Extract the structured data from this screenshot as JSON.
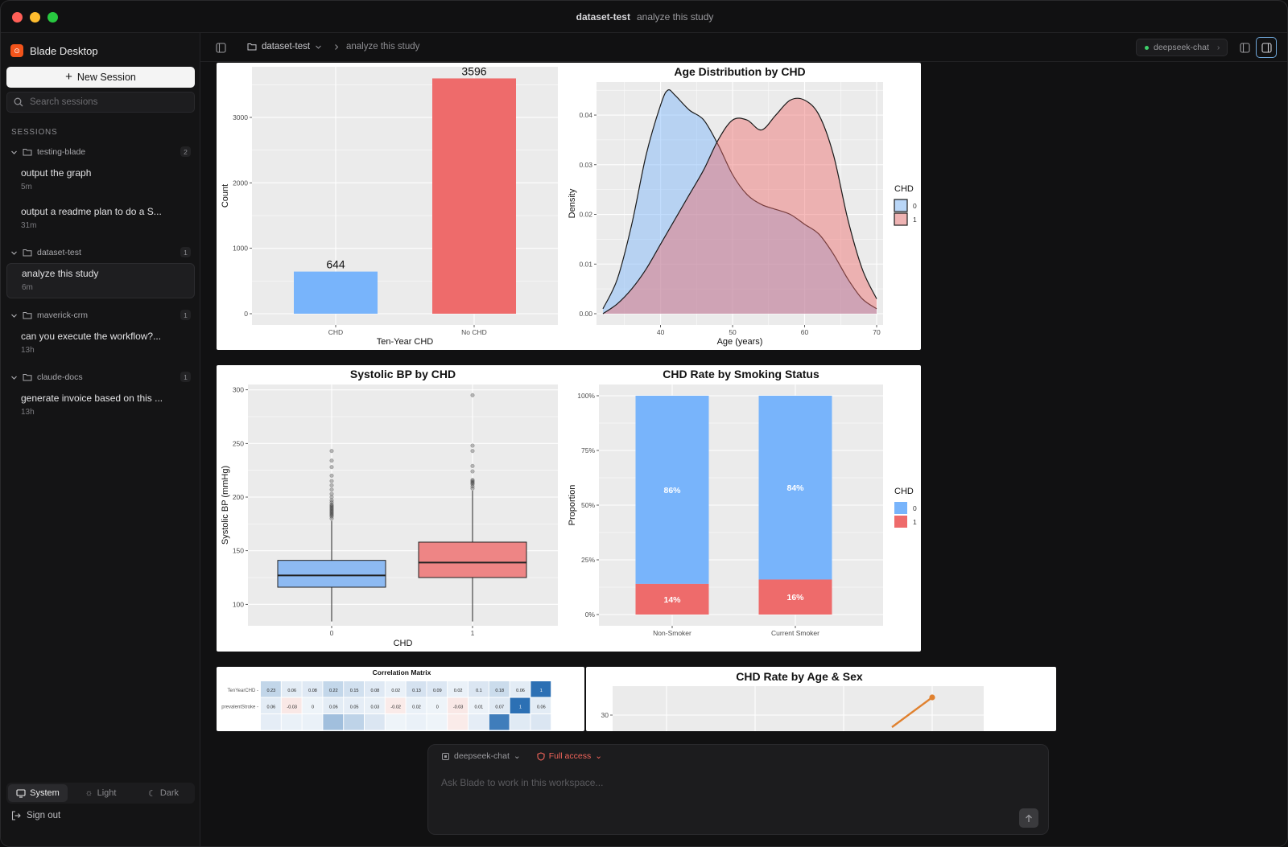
{
  "window": {
    "title_workspace": "dataset-test",
    "title_session": "analyze this study"
  },
  "sidebar": {
    "brand": "Blade Desktop",
    "new_session": "New Session",
    "search_placeholder": "Search sessions",
    "sessions_label": "SESSIONS",
    "groups": [
      {
        "name": "testing-blade",
        "count": "2",
        "items": [
          {
            "title": "output the graph",
            "time": "5m"
          },
          {
            "title": "output a readme plan to do a S...",
            "time": "31m"
          }
        ]
      },
      {
        "name": "dataset-test",
        "count": "1",
        "items": [
          {
            "title": "analyze this study",
            "time": "6m"
          }
        ]
      },
      {
        "name": "maverick-crm",
        "count": "1",
        "items": [
          {
            "title": "can you execute the workflow?...",
            "time": "13h"
          }
        ]
      },
      {
        "name": "claude-docs",
        "count": "1",
        "items": [
          {
            "title": "generate invoice based on this ...",
            "time": "13h"
          }
        ]
      }
    ],
    "theme": {
      "system": "System",
      "light": "Light",
      "dark": "Dark"
    },
    "sign_out": "Sign out"
  },
  "topbar": {
    "workspace": "dataset-test",
    "session": "analyze this study",
    "model": "deepseek-chat"
  },
  "composer": {
    "model": "deepseek-chat",
    "access": "Full access",
    "placeholder": "Ask Blade to work in this workspace..."
  },
  "colors": {
    "blue": "#78b4fb",
    "red": "#ee6b6b",
    "panel": "#ebebeb",
    "accent_orange": "#f2541b"
  },
  "chart_data": [
    {
      "type": "bar",
      "title": "",
      "xlabel": "Ten-Year CHD",
      "ylabel": "Count",
      "categories": [
        "CHD",
        "No CHD"
      ],
      "values": [
        644,
        3596
      ],
      "ylim": [
        0,
        3700
      ],
      "yticks": [
        0,
        1000,
        2000,
        3000
      ],
      "data_labels": [
        "644",
        "3596"
      ]
    },
    {
      "type": "area",
      "title": "Age Distribution by CHD",
      "xlabel": "Age (years)",
      "ylabel": "Density",
      "xticks": [
        40,
        50,
        60,
        70
      ],
      "yticks": [
        "0.00",
        "0.01",
        "0.02",
        "0.03",
        "0.04"
      ],
      "xlim": [
        32,
        70
      ],
      "ylim": [
        0,
        0.046
      ],
      "legend_title": "CHD",
      "series": [
        {
          "name": "0",
          "x": [
            32,
            34,
            36,
            38,
            40,
            41,
            42,
            44,
            46,
            48,
            50,
            52,
            54,
            56,
            58,
            60,
            62,
            64,
            66,
            68,
            70
          ],
          "y": [
            0.001,
            0.007,
            0.018,
            0.032,
            0.042,
            0.045,
            0.044,
            0.041,
            0.039,
            0.034,
            0.028,
            0.024,
            0.022,
            0.021,
            0.02,
            0.018,
            0.016,
            0.012,
            0.007,
            0.003,
            0.001
          ]
        },
        {
          "name": "1",
          "x": [
            32,
            34,
            36,
            38,
            40,
            42,
            44,
            46,
            48,
            50,
            52,
            54,
            56,
            58,
            60,
            62,
            64,
            66,
            68,
            70
          ],
          "y": [
            0.0,
            0.002,
            0.005,
            0.009,
            0.014,
            0.019,
            0.024,
            0.029,
            0.035,
            0.039,
            0.039,
            0.037,
            0.04,
            0.043,
            0.043,
            0.04,
            0.032,
            0.019,
            0.009,
            0.003
          ]
        }
      ]
    },
    {
      "type": "box",
      "title": "Systolic BP by CHD",
      "xlabel": "CHD",
      "ylabel": "Systolic BP (mmHg)",
      "categories": [
        "0",
        "1"
      ],
      "yticks": [
        100,
        150,
        200,
        250,
        300
      ],
      "ylim": [
        80,
        305
      ],
      "boxes": [
        {
          "min": 84,
          "q1": 116,
          "median": 127,
          "q3": 141,
          "max": 178,
          "outliers": [
            180,
            182,
            183,
            184,
            185,
            186,
            187,
            188,
            189,
            190,
            191,
            192,
            193,
            195,
            197,
            200,
            203,
            207,
            211,
            215,
            220,
            228,
            234,
            243
          ]
        },
        {
          "min": 84,
          "q1": 125,
          "median": 139,
          "q3": 158,
          "max": 206,
          "outliers": [
            208,
            210,
            212,
            213,
            214,
            215,
            216,
            224,
            229,
            243,
            248,
            295
          ]
        }
      ]
    },
    {
      "type": "bar",
      "stacked": true,
      "title": "CHD Rate by Smoking Status",
      "ylabel": "Proportion",
      "categories": [
        "Non-Smoker",
        "Current Smoker"
      ],
      "yticks": [
        "0%",
        "25%",
        "50%",
        "75%",
        "100%"
      ],
      "legend_title": "CHD",
      "series": [
        {
          "name": "0",
          "values": [
            0.86,
            0.84
          ],
          "labels": [
            "86%",
            "84%"
          ]
        },
        {
          "name": "1",
          "values": [
            0.14,
            0.16
          ],
          "labels": [
            "14%",
            "16%"
          ]
        }
      ]
    },
    {
      "type": "heatmap",
      "title": "Correlation Matrix",
      "rows": [
        "TenYearCHD",
        "prevalentStroke"
      ],
      "values": [
        [
          0.23,
          0.06,
          0.08,
          0.22,
          0.15,
          0.08,
          0.02,
          0.13,
          0.09,
          0.02,
          0.1,
          0.18,
          0.06,
          1
        ],
        [
          0.06,
          -0.03,
          0,
          0.06,
          0.05,
          0.03,
          -0.02,
          0.02,
          0,
          -0.03,
          0.01,
          0.07,
          1,
          0.06
        ]
      ]
    },
    {
      "type": "line",
      "title": "CHD Rate by Age & Sex",
      "yticks": [
        30
      ]
    }
  ]
}
